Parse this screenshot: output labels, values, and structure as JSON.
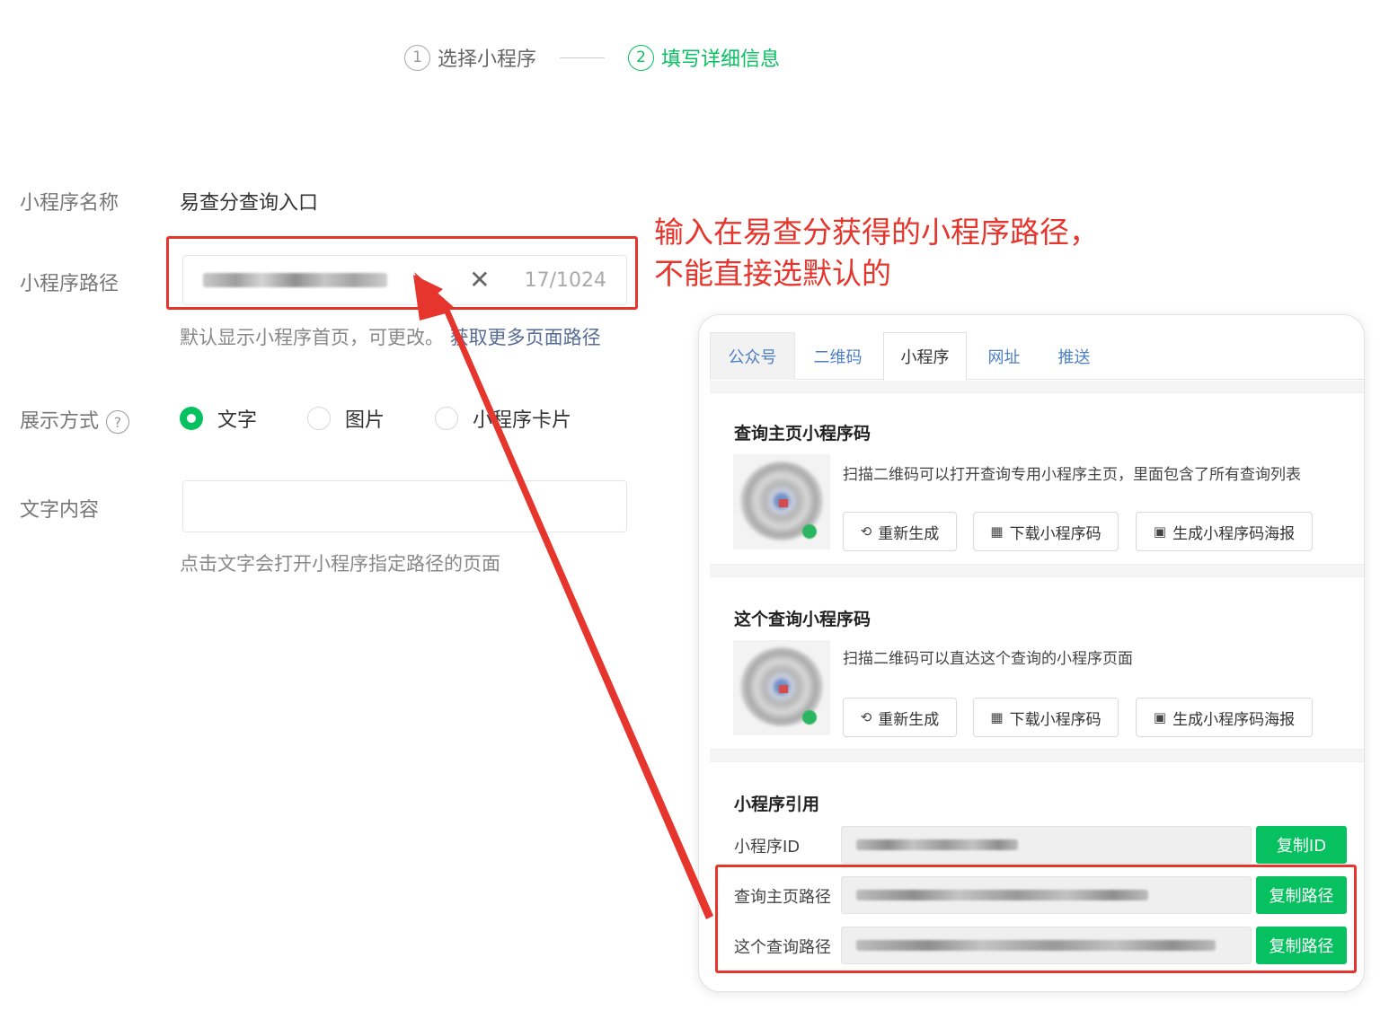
{
  "steps": [
    {
      "num": "1",
      "label": "选择小程序"
    },
    {
      "num": "2",
      "label": "填写详细信息"
    }
  ],
  "form": {
    "name_label": "小程序名称",
    "name_value": "易查分查询入口",
    "path_label": "小程序路径",
    "path_counter": "17/1024",
    "path_hint_prefix": "默认显示小程序首页，可更改。",
    "path_hint_link": "获取更多页面路径",
    "display_label": "展示方式",
    "display_options": [
      "文字",
      "图片",
      "小程序卡片"
    ],
    "display_selected": "文字",
    "text_label": "文字内容",
    "text_hint": "点击文字会打开小程序指定路径的页面"
  },
  "annotation": {
    "line1": "输入在易查分获得的小程序路径，",
    "line2": "不能直接选默认的"
  },
  "panel": {
    "tabs": [
      "公众号",
      "二维码",
      "小程序",
      "网址",
      "推送"
    ],
    "active_tab": "小程序",
    "section1": {
      "title": "查询主页小程序码",
      "desc": "扫描二维码可以打开查询专用小程序主页，里面包含了所有查询列表",
      "btn_regen": "重新生成",
      "btn_download": "下载小程序码",
      "btn_poster": "生成小程序码海报"
    },
    "section2": {
      "title": "这个查询小程序码",
      "desc": "扫描二维码可以直达这个查询的小程序页面",
      "btn_regen": "重新生成",
      "btn_download": "下载小程序码",
      "btn_poster": "生成小程序码海报"
    },
    "section3": {
      "title": "小程序引用",
      "id_label": "小程序ID",
      "id_btn": "复制ID",
      "home_label": "查询主页路径",
      "home_btn": "复制路径",
      "query_label": "这个查询路径",
      "query_btn": "复制路径"
    }
  },
  "colors": {
    "accent_green": "#07c160",
    "annotation_red": "#e5352c",
    "link_blue": "#576b95"
  },
  "icons": [
    "check-circle-icon",
    "close-icon",
    "help-icon",
    "refresh-icon",
    "qrcode-icon",
    "image-icon",
    "arrow-icon"
  ]
}
